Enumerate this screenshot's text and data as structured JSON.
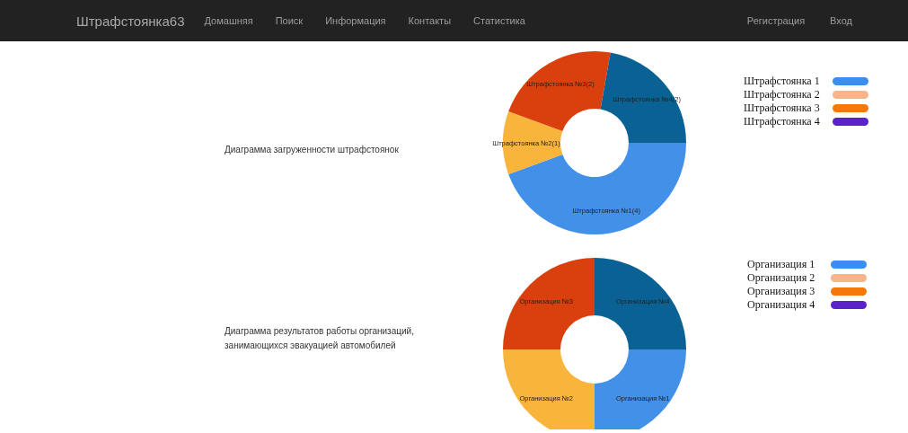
{
  "navbar": {
    "brand": "Штрафстоянка63",
    "links": [
      {
        "label": "Домашняя"
      },
      {
        "label": "Поиск"
      },
      {
        "label": "Информация"
      },
      {
        "label": "Контакты"
      },
      {
        "label": "Статистика"
      }
    ],
    "right_links": [
      {
        "label": "Регистрация"
      },
      {
        "label": "Вход"
      }
    ]
  },
  "sections": [
    {
      "caption": "Диаграмма загруженности штрафстоянок",
      "chart_data": {
        "type": "donut",
        "values": [
          4,
          1,
          2,
          2
        ],
        "colors": [
          "#4290e8",
          "#f9b43c",
          "#d9400e",
          "#0a6194"
        ],
        "value_labels": [
          "Штрафстоянка №1(4)",
          "Штрафстоянка №2(1)",
          "Штрафстоянка №3(2)",
          "Штрафстоянка №4(2)"
        ]
      },
      "legend": [
        {
          "label": "Штрафстоянка 1",
          "color": "#3a8ef0"
        },
        {
          "label": "Штрафстоянка 2",
          "color": "#f8b48a"
        },
        {
          "label": "Штрафстоянка 3",
          "color": "#f5790a"
        },
        {
          "label": "Штрафстоянка 4",
          "color": "#5a22c8"
        }
      ]
    },
    {
      "caption": "Диаграмма результатов работы организаций, занимающихся эвакуацией автомобилей",
      "chart_data": {
        "type": "donut",
        "values": [
          1,
          1,
          1,
          1
        ],
        "colors": [
          "#4290e8",
          "#f9b43c",
          "#d9400e",
          "#0a6194"
        ],
        "categories": [
          "Организация №1",
          "Организация №2",
          "Организация №3",
          "Организация №4"
        ]
      },
      "legend": [
        {
          "label": "Организация 1",
          "color": "#3a8ef0"
        },
        {
          "label": "Организация 2",
          "color": "#f8b48a"
        },
        {
          "label": "Организация 3",
          "color": "#f5790a"
        },
        {
          "label": "Организация 4",
          "color": "#5a22c8"
        }
      ]
    }
  ]
}
